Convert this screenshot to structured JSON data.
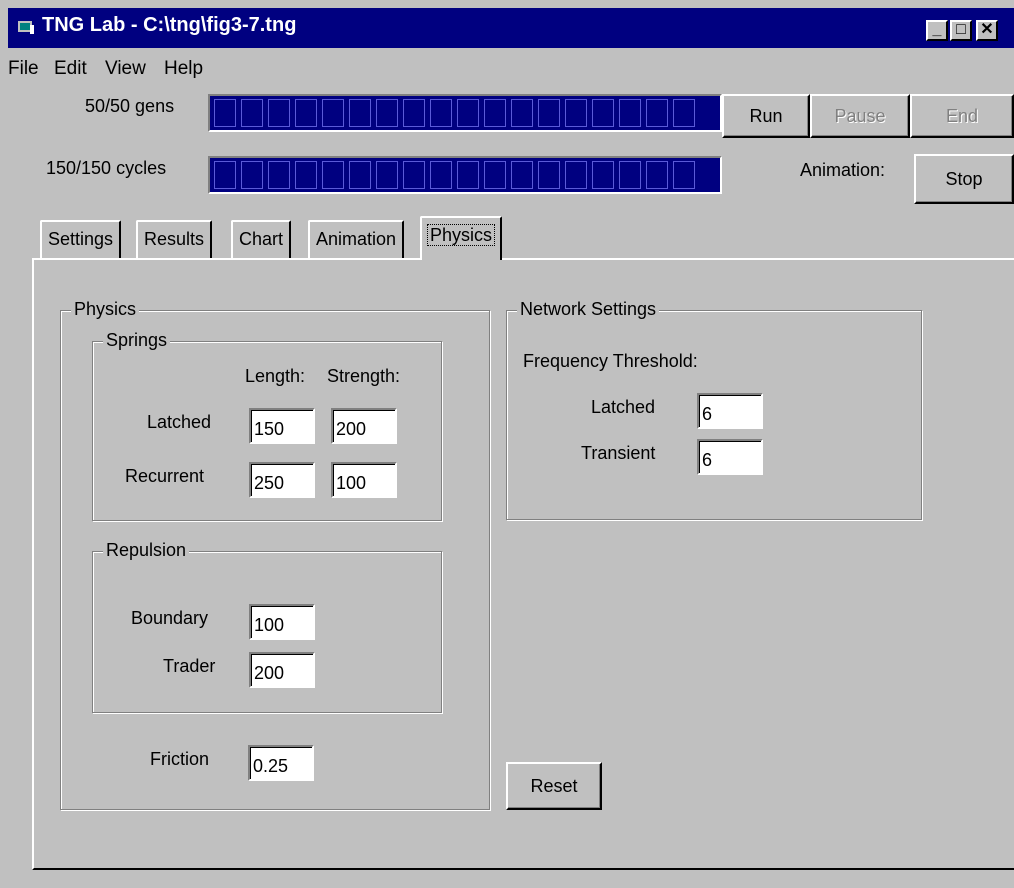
{
  "window": {
    "title": "TNG Lab - C:\\tng\\fig3-7.tng",
    "caption_buttons": [
      "minimize",
      "maximize",
      "close"
    ]
  },
  "menu": [
    "File",
    "Edit",
    "View",
    "Help"
  ],
  "progress": {
    "generations": {
      "label": "50/50 gens",
      "fraction": 1.0
    },
    "cycles": {
      "label": "150/150 cycles",
      "fraction": 1.0
    }
  },
  "controls": {
    "run": "Run",
    "pause": "Pause",
    "end": "End",
    "animation_label": "Animation:",
    "stop": "Stop"
  },
  "tabs": [
    {
      "label": "Settings",
      "active": false
    },
    {
      "label": "Results",
      "active": false
    },
    {
      "label": "Chart",
      "active": false
    },
    {
      "label": "Animation",
      "active": false
    },
    {
      "label": "Physics",
      "active": true
    }
  ],
  "physics": {
    "title": "Physics",
    "springs": {
      "title": "Springs",
      "length_header": "Length:",
      "strength_header": "Strength:",
      "latched": {
        "label": "Latched",
        "length": "150",
        "strength": "200"
      },
      "recurrent": {
        "label": "Recurrent",
        "length": "250",
        "strength": "100"
      }
    },
    "repulsion": {
      "title": "Repulsion",
      "boundary": {
        "label": "Boundary",
        "value": "100"
      },
      "trader": {
        "label": "Trader",
        "value": "200"
      }
    },
    "friction": {
      "label": "Friction",
      "value": "0.25"
    }
  },
  "network": {
    "title": "Network Settings",
    "threshold_label": "Frequency Threshold:",
    "latched": {
      "label": "Latched",
      "value": "6"
    },
    "transient": {
      "label": "Transient",
      "value": "6"
    }
  },
  "reset": "Reset"
}
